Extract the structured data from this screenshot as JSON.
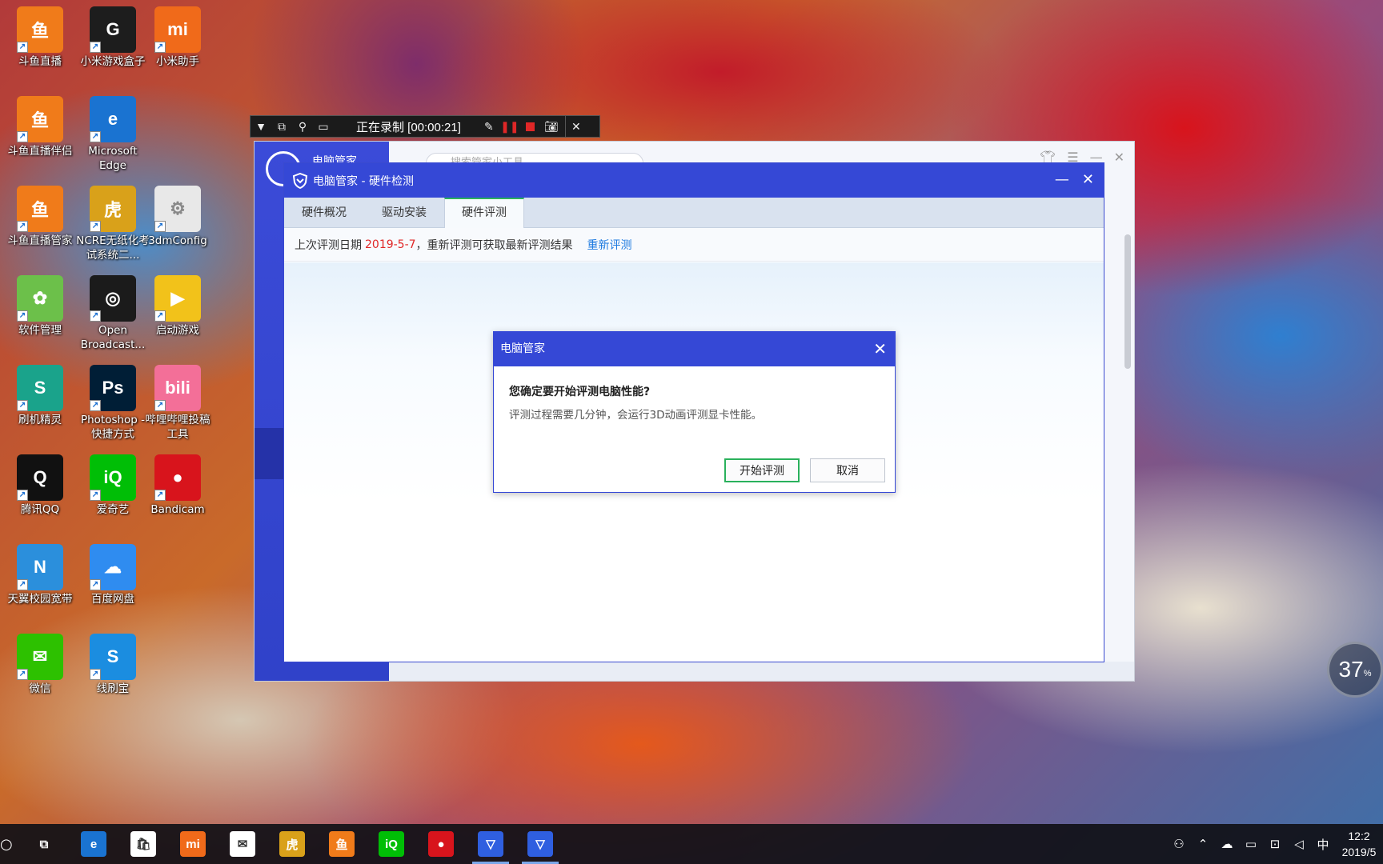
{
  "desktop": {
    "icons": [
      {
        "label": "斗鱼直播",
        "icon": "douyu-icon",
        "color": "#f07b1a"
      },
      {
        "label": "小米游戏盒子",
        "icon": "mi-game-box-icon",
        "color": "#1d1d1d"
      },
      {
        "label": "小米助手",
        "icon": "mi-assistant-icon",
        "color": "#f06a1a"
      },
      {
        "label": "斗鱼直播伴侣",
        "icon": "douyu-companion-icon",
        "color": "#f07b1a"
      },
      {
        "label": "Microsoft Edge",
        "icon": "edge-icon",
        "color": "#1a73d1"
      },
      {
        "label": "斗鱼直播管家",
        "icon": "douyu-manager-icon",
        "color": "#f07b1a"
      },
      {
        "label": "NCRE无纸化考试系统二...",
        "icon": "ncre-tiger-icon",
        "color": "#d9a11a"
      },
      {
        "label": "3dmConfig",
        "icon": "config-file-icon",
        "color": "#e8e8e8"
      },
      {
        "label": "软件管理",
        "icon": "software-manager-icon",
        "color": "#6cc04a"
      },
      {
        "label": "Open Broadcast...",
        "icon": "obs-icon",
        "color": "#1b1b1b"
      },
      {
        "label": "启动游戏",
        "icon": "launch-game-icon",
        "color": "#f2c21a"
      },
      {
        "label": "刷机精灵",
        "icon": "flash-sprite-icon",
        "color": "#1aa38b"
      },
      {
        "label": "Photoshop - 快捷方式",
        "icon": "photoshop-icon",
        "color": "#001e36"
      },
      {
        "label": "哔哩哔哩投稿工具",
        "icon": "bilibili-icon",
        "color": "#f36f98"
      },
      {
        "label": "腾讯QQ",
        "icon": "qq-penguin-icon",
        "color": "#111111"
      },
      {
        "label": "爱奇艺",
        "icon": "iqiyi-icon",
        "color": "#00be06"
      },
      {
        "label": "Bandicam",
        "icon": "bandicam-icon",
        "color": "#d8141c"
      },
      {
        "label": "天翼校园宽带",
        "icon": "tianyi-icon",
        "color": "#2b8fdc"
      },
      {
        "label": "百度网盘",
        "icon": "baidu-netdisk-icon",
        "color": "#2f8cf0"
      },
      {
        "label": "微信",
        "icon": "wechat-icon",
        "color": "#2dc100"
      },
      {
        "label": "线刷宝",
        "icon": "xianshuabao-icon",
        "color": "#1b8de0"
      }
    ]
  },
  "recorder": {
    "status": "正在录制 [00:00:21]"
  },
  "app_window": {
    "brand": "电脑管家",
    "search_placeholder": "搜索管家小工具"
  },
  "hw_window": {
    "title": "电脑管家 - 硬件检测",
    "tabs": [
      "硬件概况",
      "驱动安装",
      "硬件评测"
    ],
    "active_tab": "硬件评测",
    "info_prefix": "上次评测日期",
    "info_date": "2019-5-7",
    "info_suffix": "，重新评测可获取最新评测结果",
    "info_link": "重新评测"
  },
  "confirm_dialog": {
    "title": "电脑管家",
    "question": "您确定要开始评测电脑性能?",
    "description": "评测过程需要几分钟，会运行3D动画评测显卡性能。",
    "confirm_label": "开始评测",
    "cancel_label": "取消"
  },
  "cpu_gauge": {
    "value": "37",
    "unit": "%"
  },
  "taskbar": {
    "items": [
      {
        "icon": "task-view-icon",
        "color": "#000000"
      },
      {
        "icon": "edge-icon",
        "color": "#1a73d1"
      },
      {
        "icon": "store-icon",
        "color": "#ffffff"
      },
      {
        "icon": "mi-icon",
        "color": "#f06a1a"
      },
      {
        "icon": "mail-icon",
        "color": "#ffffff"
      },
      {
        "icon": "ncre-tiger-icon",
        "color": "#d9a11a"
      },
      {
        "icon": "douyu-icon",
        "color": "#f07b1a"
      },
      {
        "icon": "iqiyi-icon",
        "color": "#00be06"
      },
      {
        "icon": "bandicam-icon",
        "color": "#d8141c"
      },
      {
        "icon": "pc-manager-icon",
        "color": "#2f5fe0"
      },
      {
        "icon": "pc-manager-icon",
        "color": "#2f5fe0"
      }
    ],
    "ime": "中",
    "time": "12:2",
    "date": "2019/5"
  },
  "colors": {
    "accent_blue": "#3548d6",
    "highlight_red": "#e02727",
    "link_blue": "#1d7ae0",
    "primary_green": "#2ab15c"
  }
}
